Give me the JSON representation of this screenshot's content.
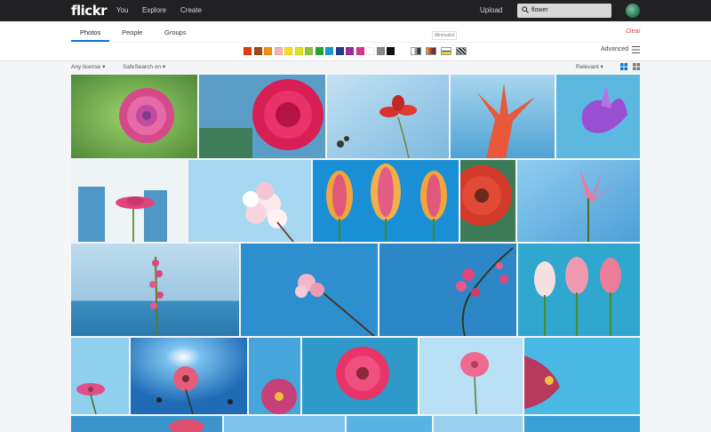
{
  "header": {
    "logo": "flickr",
    "nav": [
      "You",
      "Explore",
      "Create"
    ],
    "upload_label": "Upload",
    "search_query": "flower"
  },
  "tabs": [
    "Photos",
    "People",
    "Groups"
  ],
  "active_tab": "Photos",
  "clear_label": "Clear",
  "tooltip": "Minimalist",
  "color_swatches": [
    "#e13d12",
    "#a5481d",
    "#f39017",
    "#f6b3b4",
    "#f7df1f",
    "#e3e31b",
    "#8cc63f",
    "#24a538",
    "#1b95d8",
    "#253b93",
    "#9f2aa6",
    "#d9368b",
    "#ffffff",
    "#888888",
    "#111111"
  ],
  "selected_swatch": "#1b95d8",
  "style_filters": [
    "black-and-white",
    "shallow-depth-of-field",
    "minimalist",
    "patterns"
  ],
  "advanced_label": "Advanced",
  "filters": {
    "license": "Any license",
    "safesearch": "SafeSearch on",
    "sort": "Relevant"
  },
  "accent_color": "#0b73d6"
}
